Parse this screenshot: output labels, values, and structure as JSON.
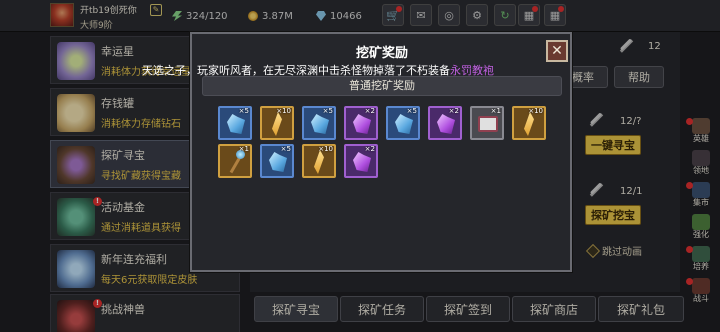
{
  "topbar": {
    "player_name": "开tb19创死你",
    "player_rank": "大师9阶",
    "energy": "324/120",
    "coins": "3.87M",
    "gems": "10466",
    "buttons": [
      "shop-icon",
      "mail-icon",
      "gamepad-icon",
      "gear-icon",
      "refresh-icon",
      "gift-icon",
      "grid-icon"
    ]
  },
  "leftmenu": {
    "items": [
      {
        "title": "幸运星",
        "sub": "消耗体力获得幸运星",
        "icon": "lucky-star-icon"
      },
      {
        "title": "存钱罐",
        "sub": "消耗体力存储钻石",
        "icon": "piggy-bank-icon"
      },
      {
        "title": "探矿寻宝",
        "sub": "寻找矿藏获得宝藏",
        "icon": "treasure-chest-icon"
      },
      {
        "title": "活动基金",
        "sub": "通过消耗道具获得",
        "icon": "fund-bag-icon"
      },
      {
        "title": "新年连充福利",
        "sub": "每天6元获取限定皮肤",
        "icon": "crystal-icon"
      },
      {
        "title": "挑战神兽",
        "sub": "",
        "icon": "beast-icon"
      }
    ]
  },
  "background": {
    "top_count": "12",
    "prob_label": "概率",
    "help_label": "帮助",
    "count1": "12/?",
    "btn_one_click": "一键寻宝",
    "count2": "12/1",
    "btn_dig": "探矿挖宝",
    "skip_label": "跳过动画"
  },
  "rail": [
    {
      "label": "英雄",
      "dot": true
    },
    {
      "label": "领地",
      "dot": false
    },
    {
      "label": "集市",
      "dot": true
    },
    {
      "label": "强化",
      "dot": false
    },
    {
      "label": "培养",
      "dot": true
    },
    {
      "label": "战斗",
      "dot": true
    }
  ],
  "bottom_tabs": [
    "探矿寻宝",
    "探矿任务",
    "探矿签到",
    "探矿商店",
    "探矿礼包"
  ],
  "modal": {
    "title": "挖矿奖励",
    "close": "✕",
    "marquee_prefix": "天选之子，玩家听风者，在无尽深渊中击杀怪物掉落了不朽装备",
    "marquee_highlight": "永罚教袍",
    "section": "普通挖矿奖励",
    "rewards": [
      {
        "type": "blue-crystal",
        "qty": "×5"
      },
      {
        "type": "gold-feather",
        "qty": "×10"
      },
      {
        "type": "blue-crystal",
        "qty": "×5"
      },
      {
        "type": "purple-crystal",
        "qty": "×2"
      },
      {
        "type": "blue-crystal",
        "qty": "×5"
      },
      {
        "type": "purple-crystal",
        "qty": "×2"
      },
      {
        "type": "chest",
        "qty": "×1"
      },
      {
        "type": "gold-feather",
        "qty": "×10"
      },
      {
        "type": "staff",
        "qty": "×1"
      },
      {
        "type": "blue-crystal",
        "qty": "×5"
      },
      {
        "type": "gold-feather",
        "qty": "×10"
      },
      {
        "type": "purple-crystal",
        "qty": "×2"
      }
    ]
  }
}
